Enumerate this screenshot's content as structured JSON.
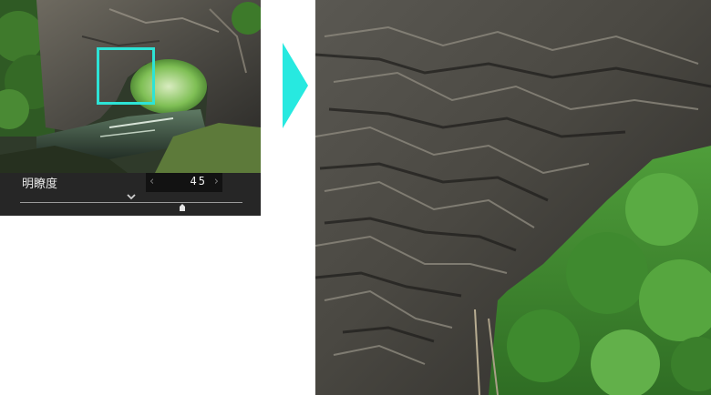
{
  "preview": {
    "param_label": "明瞭度",
    "value": "45",
    "slider_level_fraction": 0.73
  },
  "colors": {
    "focus_frame": "#2de3d6",
    "arrow": "#27e9e0",
    "panel_bg": "#262626"
  },
  "icons": {
    "stepper_prev": "‹",
    "stepper_next": "›"
  }
}
